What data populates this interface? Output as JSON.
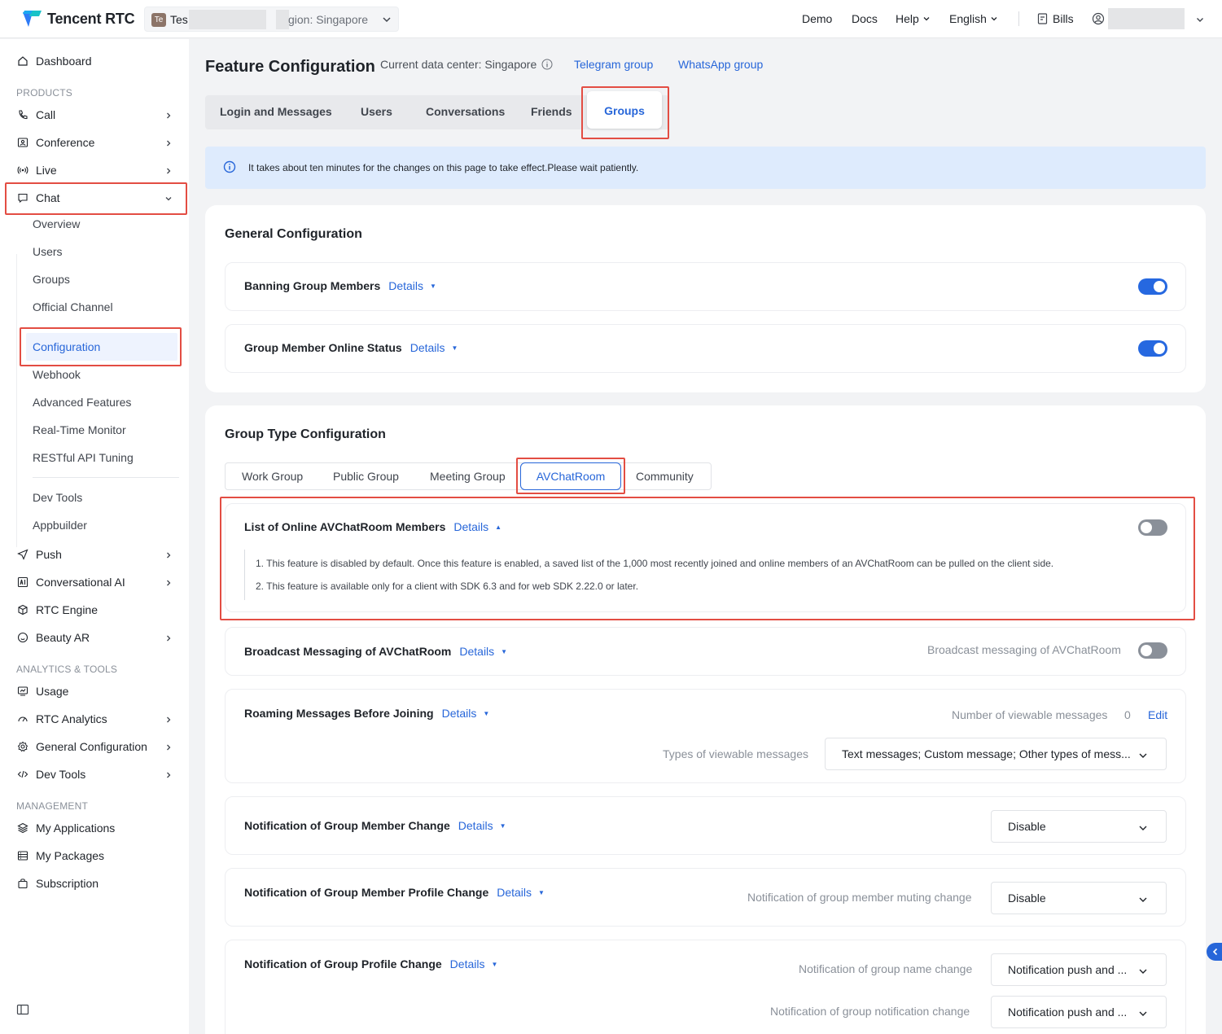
{
  "header": {
    "brand": "Tencent RTC",
    "app_badge": "Te",
    "app_name": "Tes",
    "app_region": "gion: Singapore",
    "nav": {
      "demo": "Demo",
      "docs": "Docs",
      "help": "Help",
      "language": "English",
      "bills": "Bills"
    }
  },
  "sidebar": {
    "dashboard": "Dashboard",
    "section_products": "PRODUCTS",
    "call": "Call",
    "conference": "Conference",
    "live": "Live",
    "chat": "Chat",
    "chat_sub": {
      "overview": "Overview",
      "users": "Users",
      "groups": "Groups",
      "official_channel": "Official Channel",
      "configuration": "Configuration",
      "webhook": "Webhook",
      "advanced_features": "Advanced Features",
      "realtime_monitor": "Real-Time Monitor",
      "restful_api": "RESTful API Tuning",
      "dev_tools": "Dev Tools",
      "appbuilder": "Appbuilder"
    },
    "push": "Push",
    "conversational_ai": "Conversational AI",
    "rtc_engine": "RTC Engine",
    "beauty_ar": "Beauty AR",
    "section_analytics": "ANALYTICS & TOOLS",
    "usage": "Usage",
    "rtc_analytics": "RTC Analytics",
    "general_configuration": "General Configuration",
    "dev_tools": "Dev Tools",
    "section_management": "MANAGEMENT",
    "my_applications": "My Applications",
    "my_packages": "My Packages",
    "subscription": "Subscription"
  },
  "main": {
    "title": "Feature Configuration",
    "data_center": "Current data center: Singapore",
    "telegram": "Telegram group",
    "whatsapp": "WhatsApp group",
    "tabs": [
      "Login and Messages",
      "Users",
      "Conversations",
      "Friends",
      "Groups"
    ],
    "notice": "It takes about ten minutes for the changes on this page to take effect.Please wait patiently.",
    "details_label": "Details",
    "general": {
      "title": "General Configuration",
      "banning": "Banning Group Members",
      "online_status": "Group Member Online Status"
    },
    "group_type": {
      "title": "Group Type Configuration",
      "tabs": [
        "Work Group",
        "Public Group",
        "Meeting Group",
        "AVChatRoom",
        "Community"
      ],
      "online_list": {
        "title": "List of Online AVChatRoom Members",
        "desc1": "1. This feature is disabled by default. Once this feature is enabled, a saved list of the 1,000 most recently joined and online members of an AVChatRoom can be pulled on the client side.",
        "desc2": "2. This feature is available only for a client with SDK 6.3 and for web SDK 2.22.0 or later."
      },
      "broadcast": {
        "title": "Broadcast Messaging of AVChatRoom",
        "hint": "Broadcast messaging of AVChatRoom"
      },
      "roaming": {
        "title": "Roaming Messages Before Joining",
        "viewable_label": "Number of viewable messages",
        "viewable_value": "0",
        "edit": "Edit",
        "types_label": "Types of viewable messages",
        "types_value": "Text messages; Custom message; Other types of mess..."
      },
      "member_change": {
        "title": "Notification of Group Member Change",
        "value": "Disable"
      },
      "profile_change": {
        "title": "Notification of Group Member Profile Change",
        "muting_label": "Notification of group member muting change",
        "muting_value": "Disable"
      },
      "group_profile": {
        "title": "Notification of Group Profile Change",
        "name_label": "Notification of group name change",
        "name_value": "Notification push and ...",
        "notif_label": "Notification of group notification change",
        "notif_value": "Notification push and ..."
      }
    }
  },
  "colors": {
    "accent": "#2766d9",
    "highlight": "#e34d43",
    "toggle_on": "#2668e0",
    "toggle_off": "#8a9099"
  }
}
